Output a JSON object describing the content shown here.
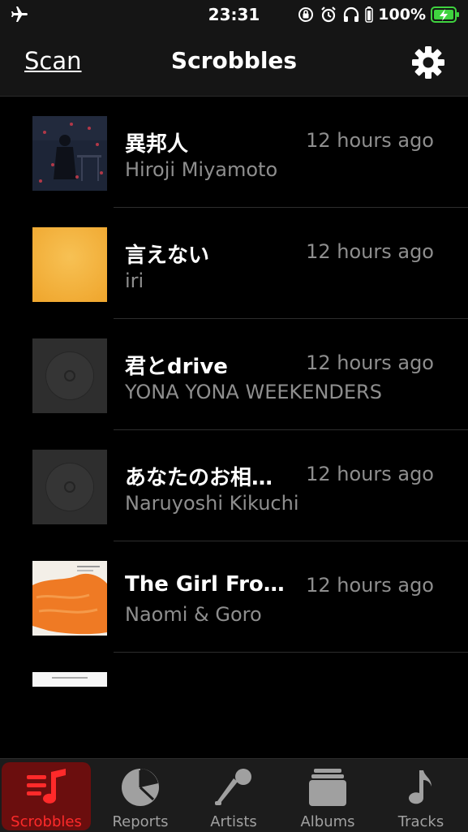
{
  "status": {
    "time": "23:31",
    "battery": "100%"
  },
  "nav": {
    "left_label": "Scan",
    "title": "Scrobbles"
  },
  "scrobbles": [
    {
      "title": "異邦人",
      "artist": "Hiroji Miyamoto",
      "time": "12 hours ago"
    },
    {
      "title": "言えない",
      "artist": "iri",
      "time": "12 hours ago"
    },
    {
      "title": "君とdrive",
      "artist": "YONA YONA WEEKENDERS",
      "time": "12 hours ago"
    },
    {
      "title": "あなたのお相…",
      "artist": "Naruyoshi Kikuchi",
      "time": "12 hours ago"
    },
    {
      "title": "The Girl Fro…",
      "artist": "Naomi & Goro",
      "time": "12 hours ago"
    }
  ],
  "tabs": [
    {
      "label": "Scrobbles",
      "icon": "scrobbles-icon",
      "active": true
    },
    {
      "label": "Reports",
      "icon": "pie-chart-icon",
      "active": false
    },
    {
      "label": "Artists",
      "icon": "microphone-icon",
      "active": false
    },
    {
      "label": "Albums",
      "icon": "albums-stack-icon",
      "active": false
    },
    {
      "label": "Tracks",
      "icon": "music-note-icon",
      "active": false
    }
  ],
  "colors": {
    "accent": "#ff2a2a",
    "active_tab_bg": "#6b0e0e",
    "secondary_text": "#8e8e8e",
    "battery": "#3fd33f"
  }
}
